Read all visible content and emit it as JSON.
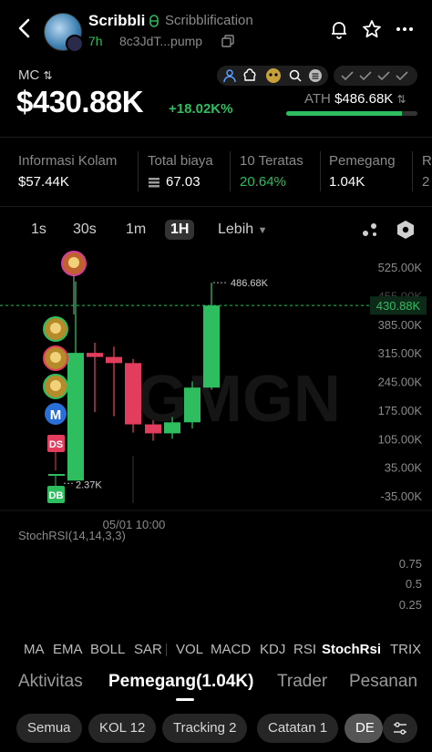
{
  "header": {
    "token_name": "Scribbli",
    "token_fullname": "Scribblification",
    "age": "7h",
    "address": "8c3JdT...pump"
  },
  "market_cap": {
    "label": "MC",
    "value": "$430.88K",
    "change": "+18.02K%",
    "ath_label": "ATH",
    "ath_value": "$486.68K",
    "ath_progress": 0.885
  },
  "stats": [
    {
      "label": "Informasi Kolam",
      "value": "$57.44K"
    },
    {
      "label": "Total biaya",
      "value": "67.03"
    },
    {
      "label": "10 Teratas",
      "value": "20.64%"
    },
    {
      "label": "Pemegang",
      "value": "1.04K"
    },
    {
      "label": "R",
      "value": "2"
    }
  ],
  "timeframes": [
    "1s",
    "30s",
    "1m",
    "1H"
  ],
  "timeframe_selected": "1H",
  "more_label": "Lebih",
  "chart_data": {
    "type": "candlestick",
    "y_ticks": [
      "525.00K",
      "455.00K",
      "385.00K",
      "315.00K",
      "245.00K",
      "175.00K",
      "105.00K",
      "35.00K",
      "-35.00K"
    ],
    "current_price": "430.88K",
    "high_label": "486.68K",
    "low_label": "2.37K",
    "x_tick": "05/01 10:00",
    "candles": [
      {
        "open": 2.37,
        "close": 315,
        "high": 490,
        "low": 2.37
      },
      {
        "open": 315,
        "close": 305,
        "high": 340,
        "low": 170
      },
      {
        "open": 305,
        "close": 290,
        "high": 330,
        "low": 160
      },
      {
        "open": 290,
        "close": 140,
        "high": 300,
        "low": 120
      },
      {
        "open": 140,
        "close": 118,
        "high": 150,
        "low": 100
      },
      {
        "open": 118,
        "close": 145,
        "high": 158,
        "low": 105
      },
      {
        "open": 145,
        "close": 230,
        "high": 245,
        "low": 130
      },
      {
        "open": 230,
        "close": 430.88,
        "high": 486.68,
        "low": 225
      }
    ],
    "markers": [
      "DS",
      "DB",
      "M"
    ],
    "stoch_label": "StochRSI(14,14,3,3)",
    "stoch_ticks": [
      "0.75",
      "0.5",
      "0.25"
    ]
  },
  "indicators": [
    "MA",
    "EMA",
    "BOLL",
    "SAR",
    "VOL",
    "MACD",
    "KDJ",
    "RSI",
    "StochRsi",
    "TRIX"
  ],
  "indicator_selected": "StochRsi",
  "tabs": [
    "Aktivitas",
    "Pemegang(1.04K)",
    "Trader",
    "Pesanan"
  ],
  "tab_selected": "Pemegang(1.04K)",
  "chips": [
    "Semua",
    "KOL 12",
    "Tracking 2",
    "Catatan 1",
    "DE"
  ],
  "colors": {
    "up": "#2ebd5f",
    "down": "#e23d5c"
  }
}
